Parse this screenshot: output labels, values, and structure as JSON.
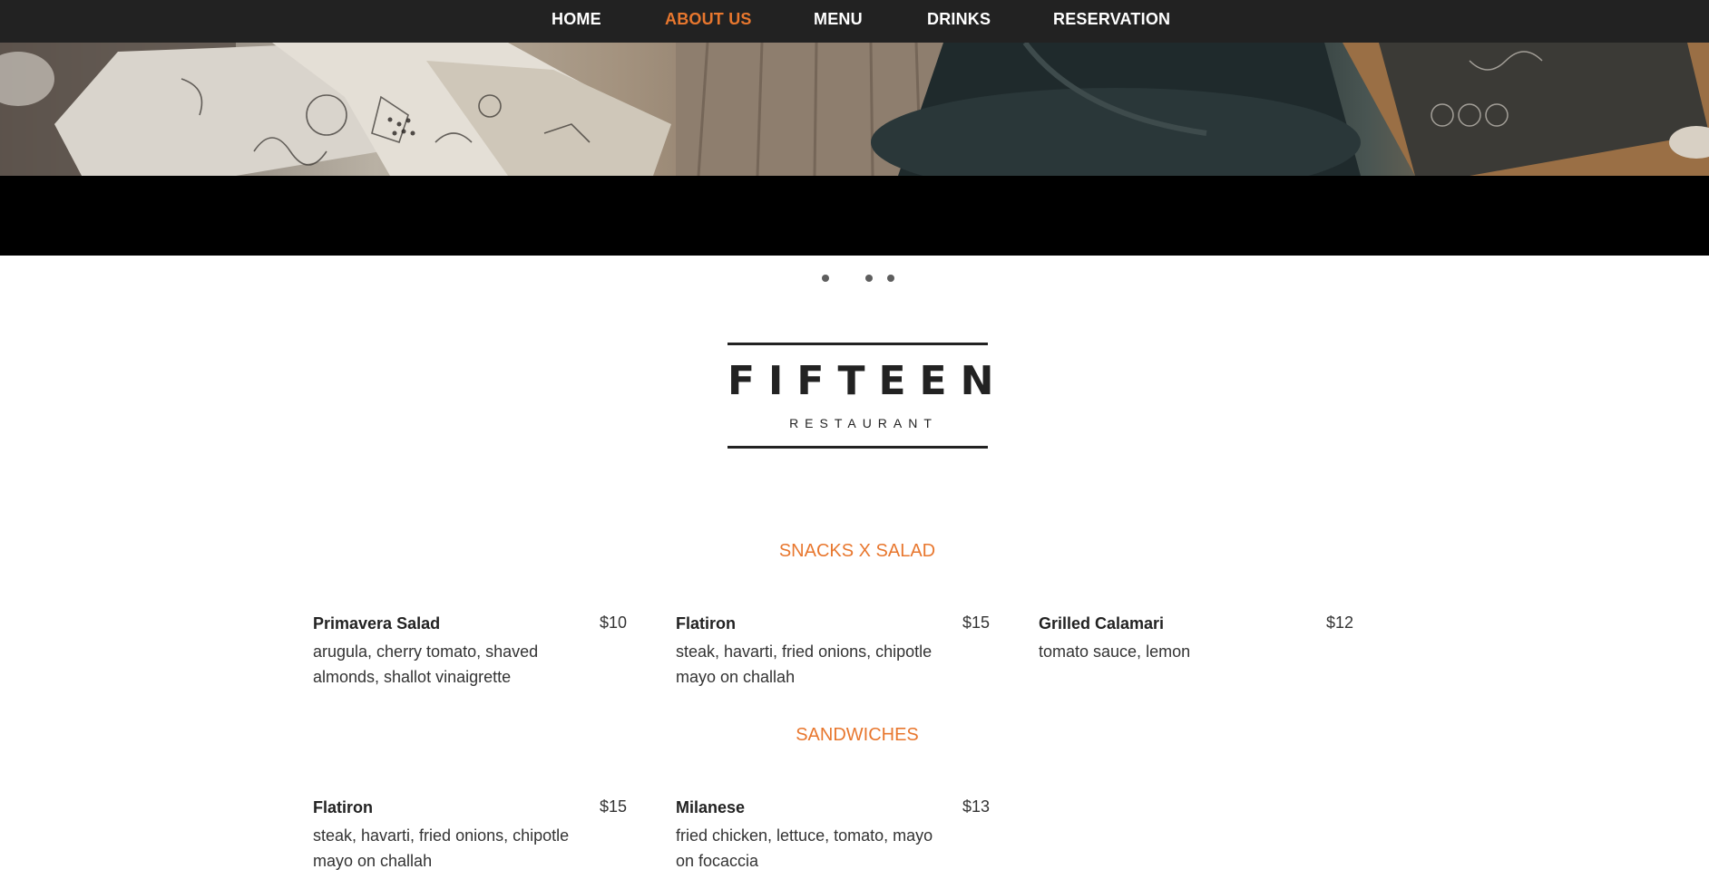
{
  "nav": {
    "items": [
      {
        "label": "HOME",
        "active": false
      },
      {
        "label": "ABOUT US",
        "active": true
      },
      {
        "label": "MENU",
        "active": false
      },
      {
        "label": "DRINKS",
        "active": false
      },
      {
        "label": "RESERVATION",
        "active": false
      }
    ]
  },
  "carousel": {
    "slide_count": 4,
    "active_slide": 2
  },
  "logo": {
    "title": "FIFTEEN",
    "subtitle": "RESTAURANT"
  },
  "sections": [
    {
      "title": "SNACKS X SALAD",
      "items": [
        {
          "name": "Primavera Salad",
          "price": "$10",
          "description": "arugula, cherry tomato, shaved almonds, shallot vinaigrette"
        },
        {
          "name": "Flatiron",
          "price": "$15",
          "description": "steak, havarti, fried onions, chipotle mayo on challah"
        },
        {
          "name": "Grilled Calamari",
          "price": "$12",
          "description": "tomato sauce, lemon"
        }
      ]
    },
    {
      "title": "SANDWICHES",
      "items": [
        {
          "name": "Flatiron",
          "price": "$15",
          "description": "steak, havarti, fried onions, chipotle mayo on challah"
        },
        {
          "name": "Milanese",
          "price": "$13",
          "description": "fried chicken, lettuce, tomato, mayo on focaccia"
        }
      ]
    }
  ],
  "colors": {
    "accent": "#e8772e",
    "nav_background": "#222222",
    "text": "#222222"
  }
}
